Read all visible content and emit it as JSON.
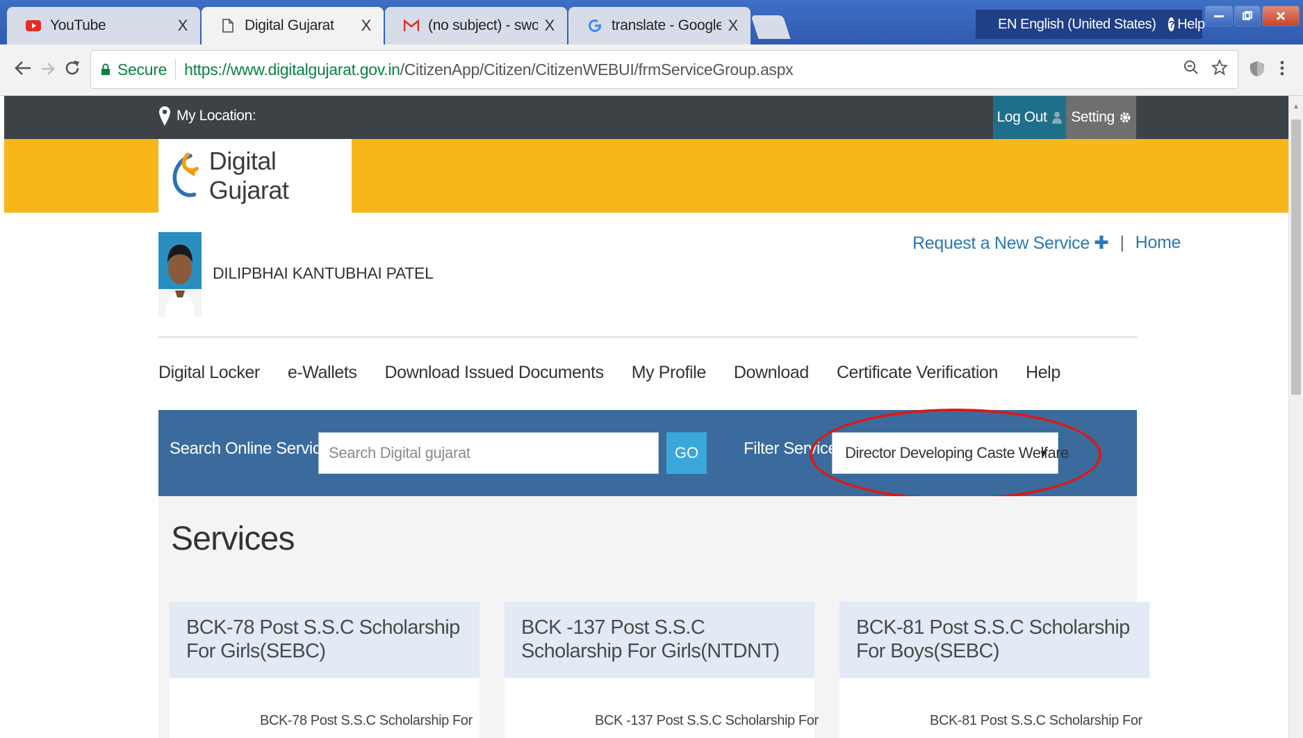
{
  "browser": {
    "tabs": [
      {
        "title": "YouTube",
        "icon": "youtube-icon"
      },
      {
        "title": "Digital Gujarat",
        "icon": "page-icon"
      },
      {
        "title": "(no subject) - swodcvalsad",
        "icon": "gmail-icon"
      },
      {
        "title": "translate - Google Search",
        "icon": "google-icon"
      }
    ],
    "close_glyph": "X",
    "language": "EN English (United States)",
    "help": "Help",
    "secure_label": "Secure",
    "url_domain": "https://www.digitalgujarat.gov.in",
    "url_path": "/CitizenApp/Citizen/CitizenWEBUI/frmServiceGroup.aspx"
  },
  "topbar": {
    "location_label": "My Location:",
    "logout_label": "Log Out",
    "setting_label": "Setting"
  },
  "brand": {
    "name": "Digital Gujarat"
  },
  "user": {
    "name": "DILIPBHAI KANTUBHAI PATEL"
  },
  "links": {
    "request": "Request a New Service",
    "separator": "|",
    "home": "Home"
  },
  "menu": [
    "Digital Locker",
    "e-Wallets",
    "Download Issued Documents",
    "My Profile",
    "Download",
    "Certificate Verification",
    "Help"
  ],
  "search": {
    "label": "Search Online Services",
    "placeholder": "Search Digital gujarat",
    "go": "GO",
    "filter_label": "Filter Services",
    "filter_value": "Director Developing Caste Welfare"
  },
  "services": {
    "heading": "Services",
    "cards": [
      {
        "title": "BCK-78 Post S.S.C Scholarship For Girls(SEBC)",
        "subtitle": "BCK-78 Post S.S.C Scholarship For"
      },
      {
        "title": "BCK -137 Post S.S.C Scholarship For Girls(NTDNT)",
        "subtitle": "BCK -137 Post S.S.C Scholarship For"
      },
      {
        "title": "BCK-81 Post S.S.C Scholarship For Boys(SEBC)",
        "subtitle": "BCK-81 Post S.S.C Scholarship For"
      }
    ]
  },
  "colors": {
    "accent": "#f7b61a",
    "search_band": "#3a6b9c",
    "link": "#2a78b5",
    "highlight": "#d81b1b"
  }
}
